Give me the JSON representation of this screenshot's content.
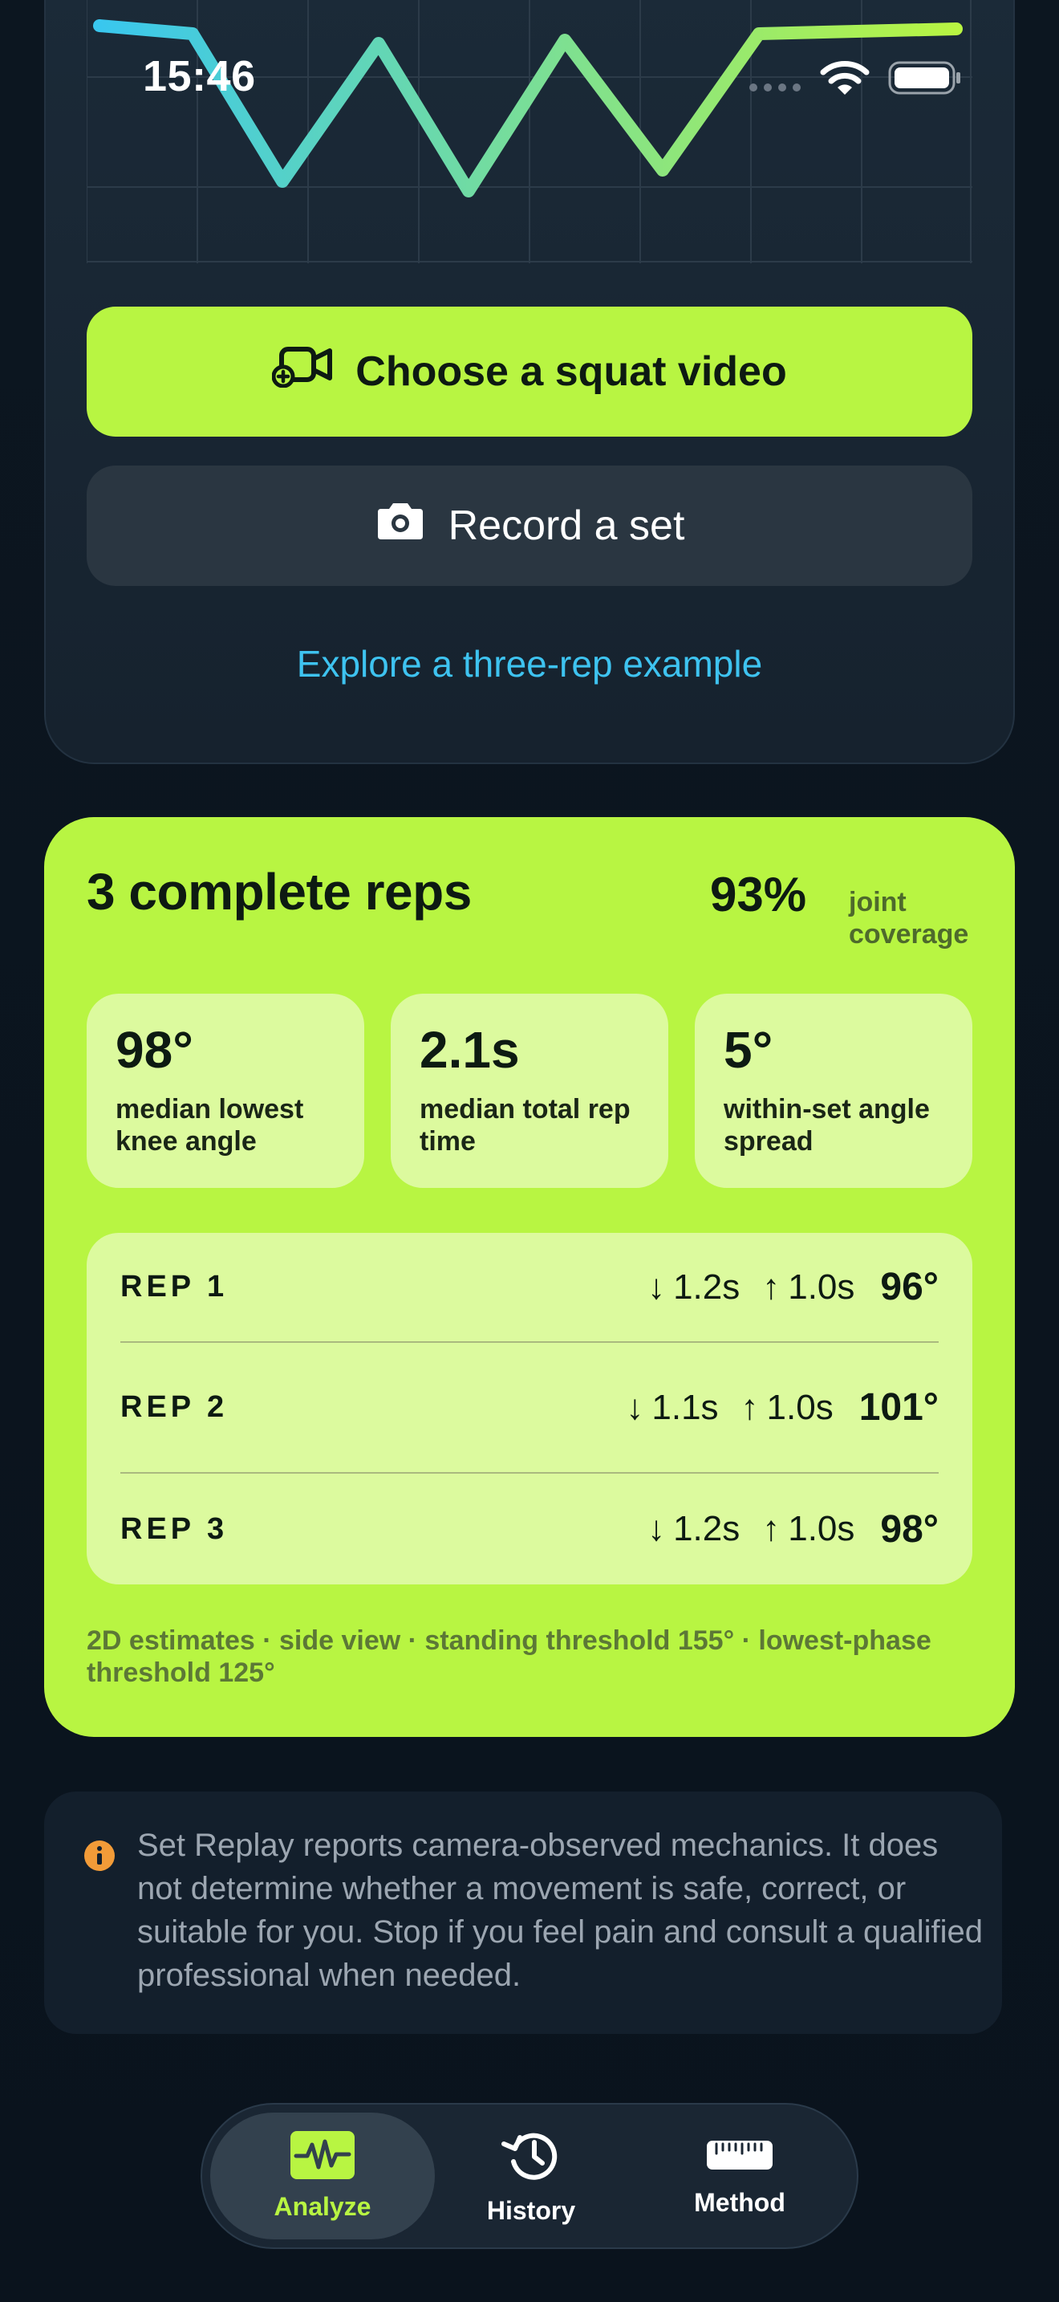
{
  "status_bar": {
    "time": "15:46"
  },
  "colors": {
    "accent": "#b8f542",
    "link": "#3ec3f0",
    "background": "#0b1420",
    "card": "#1b2a38",
    "info": "#f29b38"
  },
  "chart": {
    "line_gradient": [
      "#39c7ee",
      "#b8f542"
    ]
  },
  "actions": {
    "choose_video_label": "Choose a squat video",
    "choose_video_icon": "video-add-icon",
    "record_label": "Record a set",
    "record_icon": "camera-icon",
    "example_link": "Explore a three-rep example"
  },
  "summary": {
    "title": "3 complete reps",
    "coverage_value": "93%",
    "coverage_label": "joint coverage",
    "stats": [
      {
        "value": "98°",
        "label": "median lowest knee angle"
      },
      {
        "value": "2.1s",
        "label": "median total rep time"
      },
      {
        "value": "5°",
        "label": "within-set angle spread"
      }
    ],
    "reps": [
      {
        "name": "REP 1",
        "down": "1.2s",
        "up": "1.0s",
        "angle": "96°"
      },
      {
        "name": "REP 2",
        "down": "1.1s",
        "up": "1.0s",
        "angle": "101°"
      },
      {
        "name": "REP 3",
        "down": "1.2s",
        "up": "1.0s",
        "angle": "98°"
      }
    ],
    "footnote": "2D estimates · side view · standing threshold 155° · lowest-phase threshold 125°"
  },
  "disclaimer": {
    "icon": "info-icon",
    "text": "Set Replay reports camera-observed mechanics. It does not determine whether a movement is safe, correct, or suitable for you. Stop if you feel pain and consult a qualified professional when needed."
  },
  "tabs": [
    {
      "label": "Analyze",
      "icon": "waveform-icon",
      "active": true
    },
    {
      "label": "History",
      "icon": "history-icon",
      "active": false
    },
    {
      "label": "Method",
      "icon": "ruler-icon",
      "active": false
    }
  ]
}
